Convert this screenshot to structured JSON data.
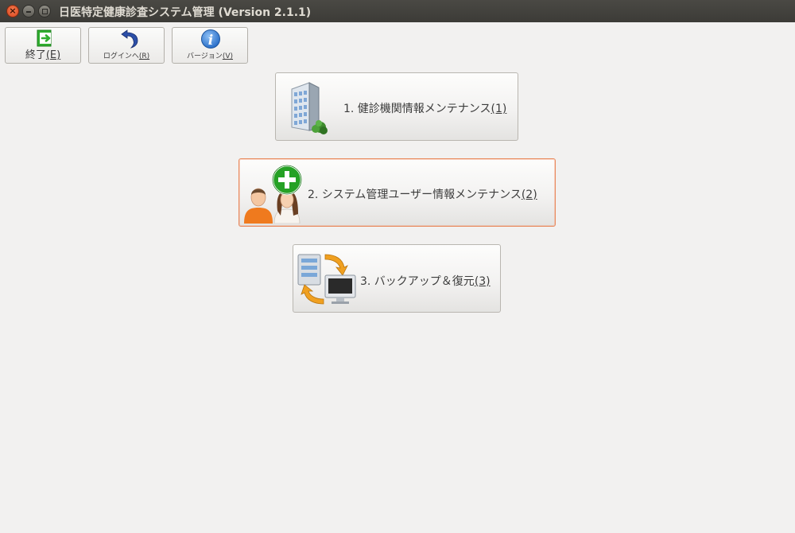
{
  "window": {
    "title": "日医特定健康診査システム管理 (Version 2.1.1)",
    "close_glyph": "×"
  },
  "toolbar": {
    "exit": {
      "label": "終了",
      "mnemonic": "(E)",
      "icon": "exit-door-icon",
      "color": "#2fae2f"
    },
    "login": {
      "label": "ログインへ",
      "mnemonic": "(R)",
      "icon": "return-arrow-icon",
      "color": "#2c4fa8"
    },
    "version": {
      "label": "バージョン",
      "mnemonic": "(V)",
      "icon": "info-icon",
      "color": "#3a7fd6"
    }
  },
  "menu": {
    "items": [
      {
        "label": "1. 健診機関情報メンテナンス",
        "mnemonic": "(1)",
        "icon": "building-icon"
      },
      {
        "label": "2. システム管理ユーザー情報メンテナンス",
        "mnemonic": "(2)",
        "icon": "add-users-icon",
        "focused": true
      },
      {
        "label": "3. バックアップ＆復元",
        "mnemonic": "(3)",
        "icon": "backup-restore-icon"
      }
    ]
  },
  "colors": {
    "title_bar": "#3c3b37",
    "background": "#f2f1f0",
    "focus_border": "#e98a5e"
  }
}
